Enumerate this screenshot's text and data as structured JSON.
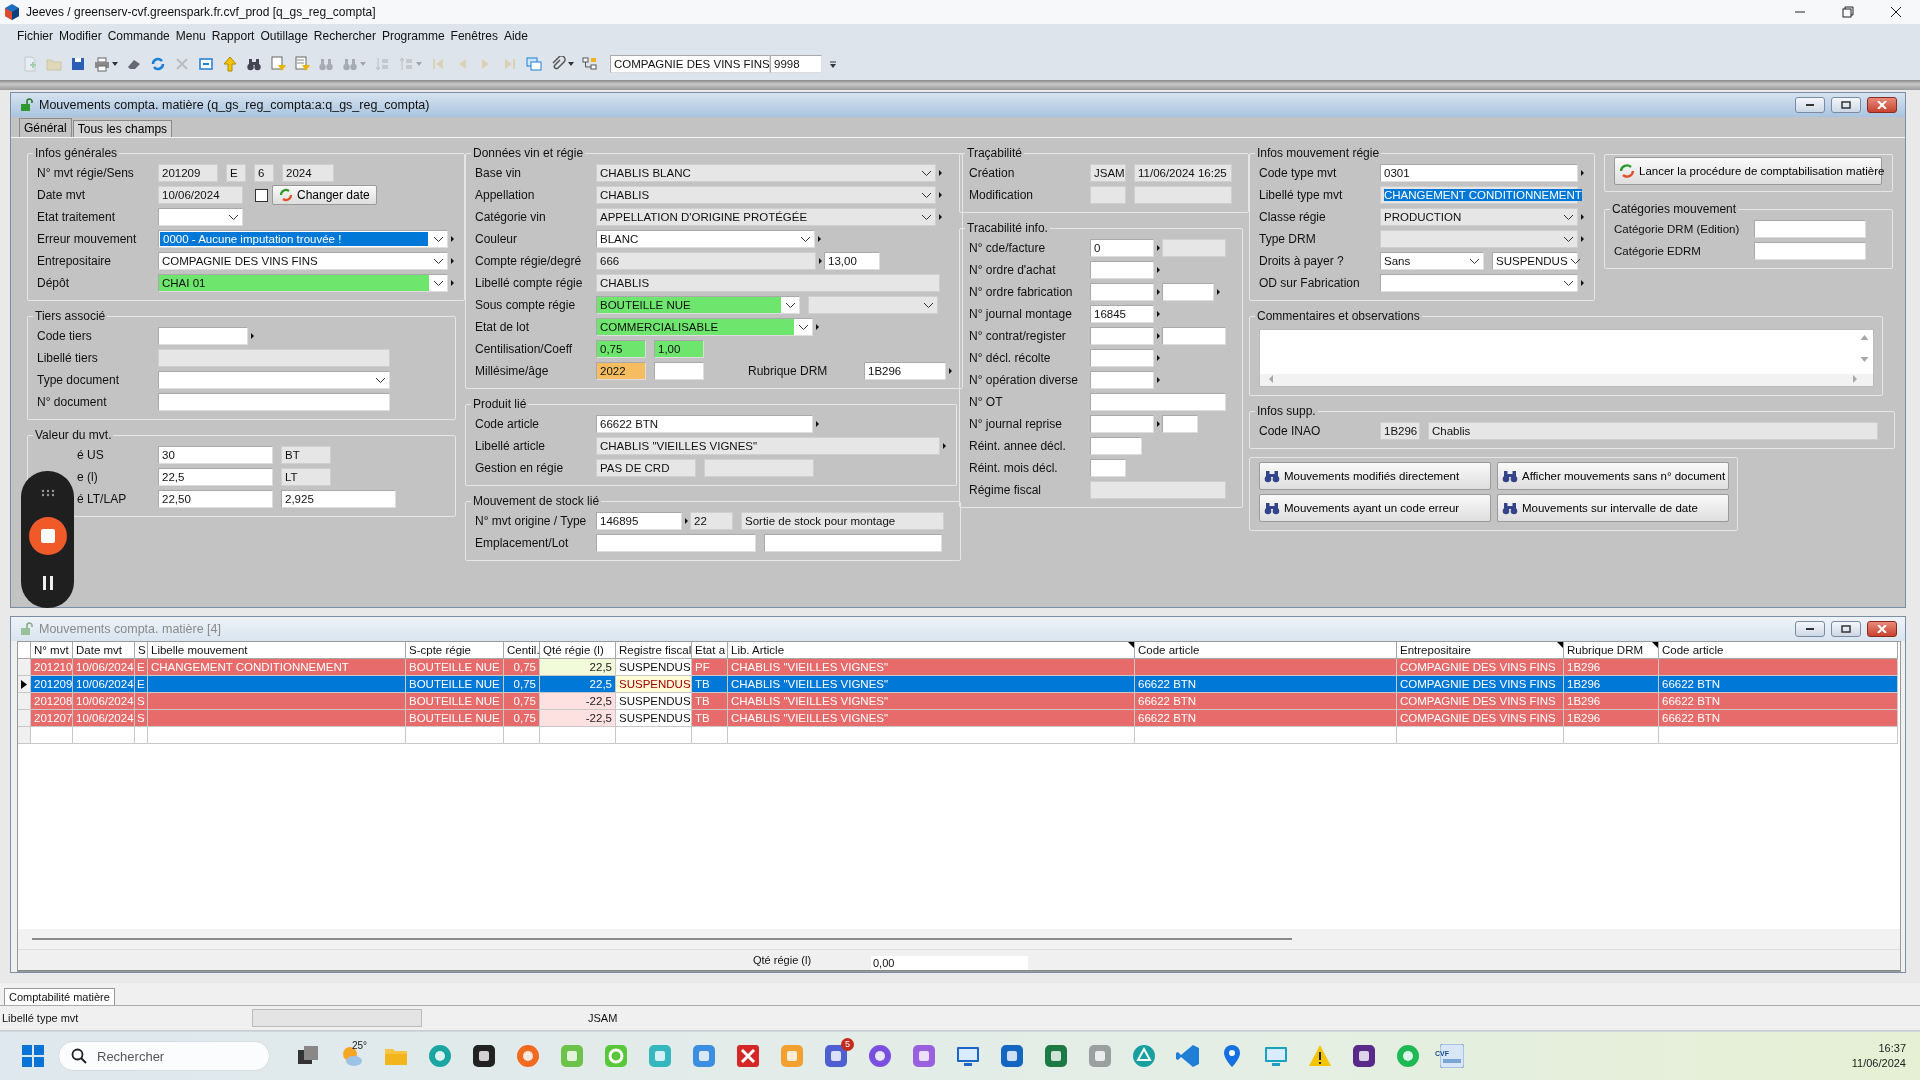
{
  "app": {
    "title": "Jeeves / greenserv-cvf.greenspark.fr.cvf_prod [q_gs_reg_compta]"
  },
  "menu": [
    "Fichier",
    "Modifier",
    "Commande",
    "Menu",
    "Rapport",
    "Outillage",
    "Rechercher",
    "Programme",
    "Fenêtres",
    "Aide"
  ],
  "toolbar": {
    "buttons": [
      {
        "disabled": true
      },
      {
        "disabled": true
      },
      {
        "disabled": false
      },
      {
        "disabled": false
      },
      {
        "disabled": false
      },
      {
        "disabled": false
      },
      {
        "disabled": true
      },
      {
        "disabled": false
      },
      {
        "disabled": false
      },
      {
        "disabled": false
      },
      {
        "disabled": false
      },
      {
        "disabled": false
      },
      {
        "disabled": true
      },
      {
        "disabled": true
      },
      {
        "disabled": true
      },
      {
        "disabled": true
      },
      {
        "disabled": true
      },
      {
        "disabled": true
      },
      {
        "disabled": true
      },
      {
        "disabled": true
      },
      {
        "disabled": false
      },
      {
        "disabled": false
      },
      {
        "disabled": false
      }
    ],
    "company": "COMPAGNIE DES VINS FINS",
    "code": "9998"
  },
  "form_window": {
    "title": "Mouvements compta. matière (q_gs_reg_compta:a:q_gs_reg_compta)",
    "active": true,
    "tabs": [
      {
        "label": "Général",
        "selected": true
      },
      {
        "label": "Tous les champs",
        "selected": false
      }
    ],
    "panels": [
      {
        "kind": "fields",
        "title": "Infos générales",
        "rows": [
          {
            "label": "N° mvt régie/Sens",
            "controls": [
              {
                "kind": "input",
                "value": "201209",
                "readonly": true,
                "lookup": false
              },
              {
                "kind": "input",
                "value": "E",
                "readonly": true,
                "lookup": false
              },
              {
                "kind": "input",
                "value": "6",
                "readonly": true,
                "lookup": false
              },
              {
                "kind": "input",
                "value": "2024",
                "readonly": true,
                "lookup": false
              }
            ]
          },
          {
            "label": "Date mvt",
            "controls": [
              {
                "kind": "input",
                "value": "10/06/2024",
                "readonly": true,
                "lookup": false
              },
              {
                "kind": "checkbox",
                "checked": false
              },
              {
                "kind": "button",
                "label": "Changer date"
              }
            ]
          },
          {
            "label": "Etat traitement",
            "controls": [
              {
                "kind": "combo",
                "readonly": false,
                "lookup": false
              }
            ]
          },
          {
            "label": "Erreur mouvement",
            "controls": [
              {
                "kind": "combo",
                "value": "0000 - Aucune imputation trouvée !",
                "readonly": false,
                "lookup": true,
                "highlighted": true
              }
            ]
          },
          {
            "label": "Entrepositaire",
            "controls": [
              {
                "kind": "combo",
                "value": "COMPAGNIE DES VINS FINS",
                "readonly": false,
                "lookup": true
              }
            ]
          },
          {
            "label": "Dépôt",
            "controls": [
              {
                "kind": "combo",
                "value": "CHAI 01",
                "readonly": false,
                "lookup": true,
                "color": "#6ee66e"
              }
            ]
          }
        ]
      },
      {
        "kind": "fields",
        "title": "Tiers associé",
        "rows": [
          {
            "label": "Code tiers",
            "controls": [
              {
                "kind": "input",
                "readonly": false,
                "lookup": true
              }
            ]
          },
          {
            "label": "Libellé tiers",
            "controls": [
              {
                "kind": "input",
                "readonly": true,
                "lookup": false
              }
            ]
          },
          {
            "label": "Type document",
            "controls": [
              {
                "kind": "combo",
                "readonly": false,
                "lookup": false
              }
            ]
          },
          {
            "label": "N° document",
            "controls": [
              {
                "kind": "input",
                "readonly": false,
                "lookup": false
              }
            ]
          }
        ]
      },
      {
        "kind": "fields",
        "title": "Valeur du mvt.",
        "rows": [
          {
            "label": "é US",
            "controls": [
              {
                "kind": "input",
                "value": "30",
                "readonly": false,
                "lookup": false
              },
              {
                "kind": "input",
                "value": "BT",
                "readonly": true,
                "lookup": false
              }
            ]
          },
          {
            "label": "e (l)",
            "controls": [
              {
                "kind": "input",
                "value": "22,5",
                "readonly": false,
                "lookup": false
              },
              {
                "kind": "input",
                "value": "LT",
                "readonly": true,
                "lookup": false
              }
            ]
          },
          {
            "label": "é LT/LAP",
            "controls": [
              {
                "kind": "input",
                "value": "22,50",
                "readonly": false,
                "lookup": false
              },
              {
                "kind": "input",
                "value": "2,925",
                "readonly": false,
                "lookup": false
              }
            ]
          }
        ]
      },
      {
        "kind": "fields",
        "title": "Données vin et régie",
        "rows": [
          {
            "label": "Base vin",
            "controls": [
              {
                "kind": "combo",
                "value": "CHABLIS BLANC",
                "readonly": true,
                "lookup": true
              }
            ]
          },
          {
            "label": "Appellation",
            "controls": [
              {
                "kind": "combo",
                "value": "CHABLIS",
                "readonly": true,
                "lookup": true
              }
            ]
          },
          {
            "label": "Catégorie vin",
            "controls": [
              {
                "kind": "combo",
                "value": "APPELLATION D'ORIGINE PROTÉGÉE",
                "readonly": true,
                "lookup": true
              }
            ]
          },
          {
            "label": "Couleur",
            "controls": [
              {
                "kind": "combo",
                "value": "BLANC",
                "readonly": false,
                "lookup": true
              }
            ]
          },
          {
            "label": "Compte régie/degré",
            "controls": [
              {
                "kind": "input",
                "value": "666",
                "readonly": true,
                "lookup": true
              },
              {
                "kind": "input",
                "value": "13,00",
                "readonly": false,
                "lookup": false
              }
            ]
          },
          {
            "label": "Libellé compte régie",
            "controls": [
              {
                "kind": "input",
                "value": "CHABLIS",
                "readonly": true,
                "lookup": false
              }
            ]
          },
          {
            "label": "Sous compte régie",
            "controls": [
              {
                "kind": "combo",
                "value": "BOUTEILLE NUE",
                "readonly": false,
                "lookup": false,
                "color": "#6ee66e"
              },
              {
                "kind": "combo",
                "readonly": true,
                "lookup": false
              }
            ]
          },
          {
            "label": "Etat de lot",
            "controls": [
              {
                "kind": "combo",
                "value": "COMMERCIALISABLE",
                "readonly": false,
                "lookup": true,
                "color": "#6ee66e"
              }
            ]
          },
          {
            "label": "Centilisation/Coeff",
            "controls": [
              {
                "kind": "input",
                "value": "0,75",
                "readonly": false,
                "lookup": false,
                "color": "#6ee66e"
              },
              {
                "kind": "input",
                "value": "1,00",
                "readonly": false,
                "lookup": false,
                "color": "#6ee66e"
              }
            ]
          },
          {
            "label": "Millésime/âge",
            "controls": [
              {
                "kind": "input",
                "value": "2022",
                "readonly": false,
                "lookup": false,
                "color": "#f5bd5f"
              },
              {
                "kind": "input",
                "readonly": false,
                "lookup": false
              },
              {
                "kind": "text",
                "label": "Rubrique DRM"
              },
              {
                "kind": "input",
                "value": "1B296",
                "readonly": false,
                "lookup": true
              }
            ]
          }
        ]
      },
      {
        "kind": "fields",
        "title": "Produit lié",
        "rows": [
          {
            "label": "Code article",
            "controls": [
              {
                "kind": "input",
                "value": "66622   BTN",
                "readonly": false,
                "lookup": true
              }
            ]
          },
          {
            "label": "Libellé article",
            "controls": [
              {
                "kind": "input",
                "value": "CHABLIS \"VIEILLES VIGNES\"",
                "readonly": true,
                "lookup": true
              }
            ]
          },
          {
            "label": "Gestion en régie",
            "controls": [
              {
                "kind": "input",
                "value": "PAS DE CRD",
                "readonly": true,
                "lookup": false
              },
              {
                "kind": "input",
                "readonly": true,
                "lookup": false
              }
            ]
          }
        ]
      },
      {
        "kind": "fields",
        "title": "Mouvement de stock lié",
        "rows": [
          {
            "label": "N° mvt origine / Type",
            "controls": [
              {
                "kind": "input",
                "value": "146895",
                "readonly": false,
                "lookup": true
              },
              {
                "kind": "input",
                "value": "22",
                "readonly": true,
                "lookup": false
              },
              {
                "kind": "input",
                "value": "Sortie de stock pour montage",
                "readonly": true,
                "lookup": false
              }
            ]
          },
          {
            "label": "Emplacement/Lot",
            "controls": [
              {
                "kind": "input",
                "readonly": false,
                "lookup": false
              },
              {
                "kind": "input",
                "readonly": false,
                "lookup": false
              }
            ]
          }
        ]
      },
      {
        "kind": "fields",
        "title": "Traçabilité",
        "rows": [
          {
            "label": "Création",
            "controls": [
              {
                "kind": "input",
                "value": "JSAM",
                "readonly": true,
                "lookup": false
              },
              {
                "kind": "input",
                "value": "11/06/2024 16:25",
                "readonly": true,
                "lookup": false
              }
            ]
          },
          {
            "label": "Modification",
            "controls": [
              {
                "kind": "input",
                "readonly": true,
                "lookup": false
              },
              {
                "kind": "input",
                "readonly": true,
                "lookup": false
              }
            ]
          }
        ]
      },
      {
        "kind": "fields",
        "title": "Tracabilité info.",
        "rows": [
          {
            "label": "N° cde/facture",
            "controls": [
              {
                "kind": "input",
                "value": "0",
                "readonly": false,
                "lookup": true
              },
              {
                "kind": "input",
                "readonly": true,
                "lookup": false
              }
            ]
          },
          {
            "label": "N° ordre d'achat",
            "controls": [
              {
                "kind": "input",
                "readonly": false,
                "lookup": true
              }
            ]
          },
          {
            "label": "N° ordre fabrication",
            "controls": [
              {
                "kind": "input",
                "readonly": false,
                "lookup": true
              },
              {
                "kind": "input",
                "readonly": false,
                "lookup": true
              }
            ]
          },
          {
            "label": "N° journal montage",
            "controls": [
              {
                "kind": "input",
                "value": "16845",
                "readonly": false,
                "lookup": true
              }
            ]
          },
          {
            "label": "N° contrat/register",
            "controls": [
              {
                "kind": "input",
                "readonly": false,
                "lookup": true
              },
              {
                "kind": "input",
                "readonly": false,
                "lookup": false
              }
            ]
          },
          {
            "label": "N° décl. récolte",
            "controls": [
              {
                "kind": "input",
                "readonly": false,
                "lookup": true
              }
            ]
          },
          {
            "label": "N° opération diverse",
            "controls": [
              {
                "kind": "input",
                "readonly": false,
                "lookup": true
              }
            ]
          },
          {
            "label": "N° OT",
            "controls": [
              {
                "kind": "input",
                "readonly": false,
                "lookup": false
              }
            ]
          },
          {
            "label": "N° journal reprise",
            "controls": [
              {
                "kind": "input",
                "readonly": false,
                "lookup": true
              },
              {
                "kind": "input",
                "readonly": false,
                "lookup": false
              }
            ]
          },
          {
            "label": "Réint. annee décl.",
            "controls": [
              {
                "kind": "input",
                "readonly": false,
                "lookup": false
              }
            ]
          },
          {
            "label": "Réint. mois décl.",
            "controls": [
              {
                "kind": "input",
                "readonly": false,
                "lookup": false
              }
            ]
          },
          {
            "label": "Régime fiscal",
            "controls": [
              {
                "kind": "input",
                "readonly": true,
                "lookup": false
              }
            ]
          }
        ]
      },
      {
        "kind": "fields",
        "title": "Infos mouvement régie",
        "rows": [
          {
            "label": "Code type mvt",
            "controls": [
              {
                "kind": "input",
                "value": "0301",
                "readonly": false,
                "lookup": true
              }
            ]
          },
          {
            "label": "Libellé type mvt",
            "controls": [
              {
                "kind": "input",
                "value": "CHANGEMENT CONDITIONNEMENT",
                "readonly": true,
                "lookup": false,
                "highlighted": true
              }
            ]
          },
          {
            "label": "Classe régie",
            "controls": [
              {
                "kind": "combo",
                "value": "PRODUCTION",
                "readonly": true,
                "lookup": true
              }
            ]
          },
          {
            "label": "Type DRM",
            "controls": [
              {
                "kind": "combo",
                "readonly": true,
                "lookup": true
              }
            ]
          },
          {
            "label": "Droits à payer ?",
            "controls": [
              {
                "kind": "combo",
                "value": "Sans",
                "readonly": false,
                "lookup": false
              },
              {
                "kind": "combo",
                "value": "SUSPENDUS",
                "readonly": false,
                "lookup": false
              }
            ]
          },
          {
            "label": "OD sur Fabrication",
            "controls": [
              {
                "kind": "combo",
                "readonly": false,
                "lookup": true
              }
            ]
          }
        ]
      },
      {
        "kind": "buttons",
        "buttons": [
          "Lancer la procédure de comptabilisation matière"
        ]
      },
      {
        "kind": "fields",
        "title": "Catégories mouvement",
        "rows": [
          {
            "label": "Catégorie DRM (Edition)",
            "controls": [
              {
                "kind": "input",
                "readonly": false,
                "lookup": false
              }
            ]
          },
          {
            "label": "Catégorie EDRM",
            "controls": [
              {
                "kind": "input",
                "readonly": false,
                "lookup": false
              }
            ]
          }
        ]
      },
      {
        "kind": "comments",
        "title": "Commentaires et observations"
      },
      {
        "kind": "fields",
        "title": "Infos supp.",
        "rows": [
          {
            "label": "Code INAO",
            "controls": [
              {
                "kind": "input",
                "value": "1B296",
                "readonly": true,
                "lookup": false
              },
              {
                "kind": "input",
                "value": "Chablis",
                "readonly": true,
                "lookup": false
              }
            ]
          }
        ]
      },
      {
        "kind": "buttons",
        "buttons": [
          "Mouvements modifiés directement",
          "Afficher mouvements sans n° document",
          "Mouvements ayant un code erreur",
          "Mouvements sur intervalle de date"
        ]
      }
    ]
  },
  "list_window": {
    "title": "Mouvements compta. matière [4]",
    "active": false,
    "columns": [
      {
        "label": "N° mvt",
        "marked": false
      },
      {
        "label": "Date mvt",
        "marked": false
      },
      {
        "label": "S",
        "marked": false
      },
      {
        "label": "Libelle mouvement",
        "marked": false
      },
      {
        "label": "S-cpte régie",
        "marked": false
      },
      {
        "label": "Centil.",
        "marked": false
      },
      {
        "label": "Qté régie (l)",
        "marked": false
      },
      {
        "label": "Registre fiscal",
        "marked": false
      },
      {
        "label": "Etat a",
        "marked": false
      },
      {
        "label": "Lib. Article",
        "marked": true
      },
      {
        "label": "Code article",
        "marked": false
      },
      {
        "label": "Entrepositaire",
        "marked": true
      },
      {
        "label": "Rubrique DRM",
        "marked": true
      },
      {
        "label": "Code article",
        "marked": false
      }
    ],
    "rows": [
      {
        "selected": false,
        "color": "#f1fbd9",
        "cells": [
          "201210",
          "10/06/2024",
          "E",
          "CHANGEMENT CONDITIONNEMENT",
          "BOUTEILLE NUE",
          "0,75",
          "22,5",
          "SUSPENDUS",
          "PF",
          "CHABLIS \"VIEILLES VIGNES\"",
          null,
          "COMPAGNIE DES VINS FINS",
          "1B296",
          null
        ]
      },
      {
        "selected": true,
        "cells": [
          "201209",
          "10/06/2024",
          "E",
          null,
          "BOUTEILLE NUE",
          "0,75",
          "22,5",
          "SUSPENDUS",
          "TB",
          "CHABLIS \"VIEILLES VIGNES\"",
          "66622   BTN",
          "COMPAGNIE DES VINS FINS",
          "1B296",
          "66622   BTN"
        ]
      },
      {
        "selected": false,
        "color": "#fde0e0",
        "cells": [
          "201208",
          "10/06/2024",
          "S",
          null,
          "BOUTEILLE NUE",
          "0,75",
          "-22,5",
          "SUSPENDUS",
          "TB",
          "CHABLIS \"VIEILLES VIGNES\"",
          "66622   BTN",
          "COMPAGNIE DES VINS FINS",
          "1B296",
          "66622   BTN"
        ]
      },
      {
        "selected": false,
        "color": "#fde0e0",
        "cells": [
          "201207",
          "10/06/2024",
          "S",
          null,
          "BOUTEILLE NUE",
          "0,75",
          "-22,5",
          "SUSPENDUS",
          "TB",
          "CHABLIS \"VIEILLES VIGNES\"",
          "66622   BTN",
          "COMPAGNIE DES VINS FINS",
          "1B296",
          "66622   BTN"
        ]
      }
    ],
    "footer": {
      "label": "Qté régie (l)",
      "value": "0,00"
    }
  },
  "module_tab": {
    "label": "Comptabilité matière",
    "selected": true
  },
  "status_bar": {
    "field": "Libellé type mvt",
    "user": "JSAM"
  },
  "recorder_overlay": {
    "recording": true
  },
  "taskbar": {
    "search_placeholder": "Rechercher",
    "weather": "25°",
    "badge": "5",
    "active_app_label": "CVF",
    "time": "16:37",
    "date": "11/06/2024"
  }
}
